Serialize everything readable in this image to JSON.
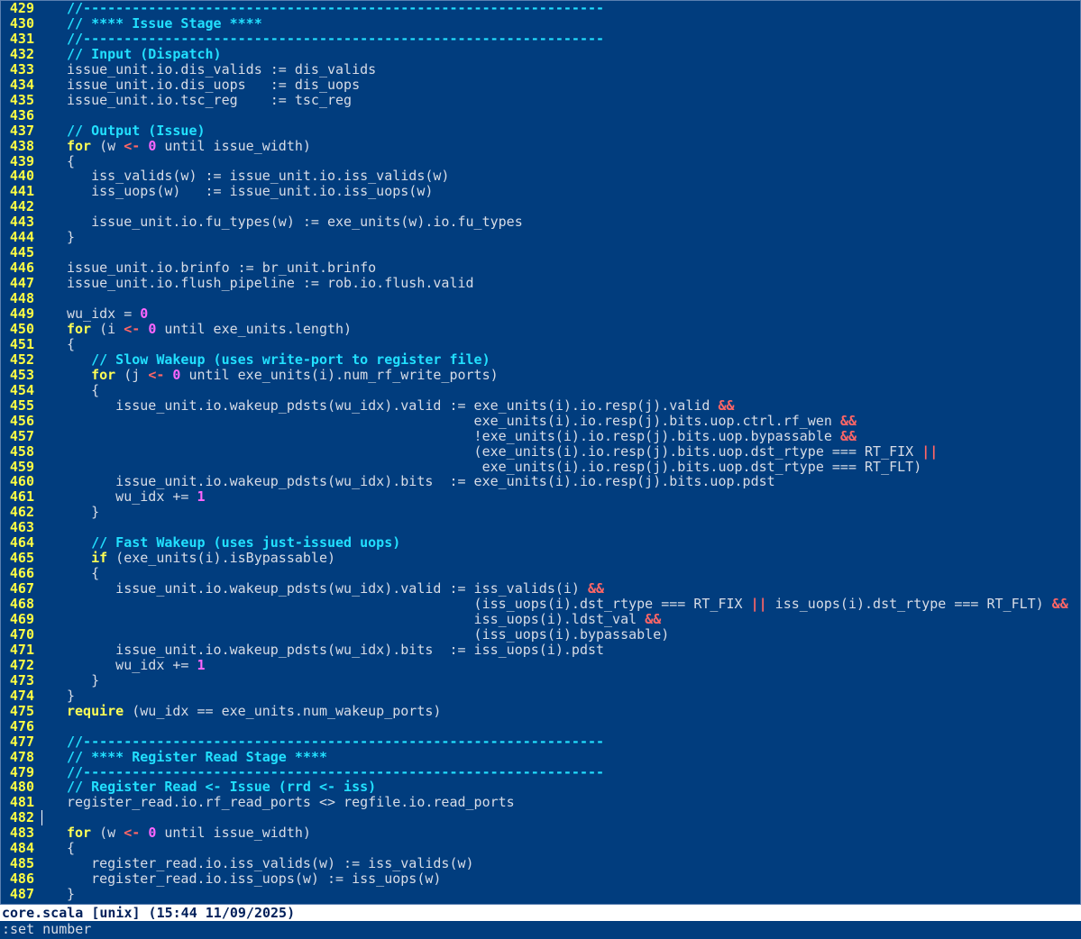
{
  "editor": {
    "file": "core.scala",
    "lines": [
      {
        "n": "429",
        "tokens": [
          [
            "comment",
            "//----------------------------------------------------------------"
          ]
        ]
      },
      {
        "n": "430",
        "tokens": [
          [
            "comment",
            "// **** Issue Stage ****"
          ]
        ]
      },
      {
        "n": "431",
        "tokens": [
          [
            "comment",
            "//----------------------------------------------------------------"
          ]
        ]
      },
      {
        "n": "432",
        "tokens": [
          [
            "comment",
            "// Input (Dispatch)"
          ]
        ]
      },
      {
        "n": "433",
        "tokens": [
          [
            "plain",
            "issue_unit.io.dis_valids := dis_valids"
          ]
        ]
      },
      {
        "n": "434",
        "tokens": [
          [
            "plain",
            "issue_unit.io.dis_uops   := dis_uops"
          ]
        ]
      },
      {
        "n": "435",
        "tokens": [
          [
            "plain",
            "issue_unit.io.tsc_reg    := tsc_reg"
          ]
        ]
      },
      {
        "n": "436",
        "tokens": []
      },
      {
        "n": "437",
        "tokens": [
          [
            "comment",
            "// Output (Issue)"
          ]
        ]
      },
      {
        "n": "438",
        "tokens": [
          [
            "keyword",
            "for"
          ],
          [
            "plain",
            " (w "
          ],
          [
            "op",
            "<-"
          ],
          [
            "plain",
            " "
          ],
          [
            "number",
            "0"
          ],
          [
            "plain",
            " until issue_width)"
          ]
        ]
      },
      {
        "n": "439",
        "tokens": [
          [
            "plain",
            "{"
          ]
        ]
      },
      {
        "n": "440",
        "tokens": [
          [
            "plain",
            "   iss_valids(w) := issue_unit.io.iss_valids(w)"
          ]
        ]
      },
      {
        "n": "441",
        "tokens": [
          [
            "plain",
            "   iss_uops(w)   := issue_unit.io.iss_uops(w)"
          ]
        ]
      },
      {
        "n": "442",
        "tokens": []
      },
      {
        "n": "443",
        "tokens": [
          [
            "plain",
            "   issue_unit.io.fu_types(w) := exe_units(w).io.fu_types"
          ]
        ]
      },
      {
        "n": "444",
        "tokens": [
          [
            "plain",
            "}"
          ]
        ]
      },
      {
        "n": "445",
        "tokens": []
      },
      {
        "n": "446",
        "tokens": [
          [
            "plain",
            "issue_unit.io.brinfo := br_unit.brinfo"
          ]
        ]
      },
      {
        "n": "447",
        "tokens": [
          [
            "plain",
            "issue_unit.io.flush_pipeline := rob.io.flush.valid"
          ]
        ]
      },
      {
        "n": "448",
        "tokens": []
      },
      {
        "n": "449",
        "tokens": [
          [
            "plain",
            "wu_idx = "
          ],
          [
            "number",
            "0"
          ]
        ]
      },
      {
        "n": "450",
        "tokens": [
          [
            "keyword",
            "for"
          ],
          [
            "plain",
            " (i "
          ],
          [
            "op",
            "<-"
          ],
          [
            "plain",
            " "
          ],
          [
            "number",
            "0"
          ],
          [
            "plain",
            " until exe_units.length)"
          ]
        ]
      },
      {
        "n": "451",
        "tokens": [
          [
            "plain",
            "{"
          ]
        ]
      },
      {
        "n": "452",
        "tokens": [
          [
            "plain",
            "   "
          ],
          [
            "comment",
            "// Slow Wakeup (uses write-port to register file)"
          ]
        ]
      },
      {
        "n": "453",
        "tokens": [
          [
            "plain",
            "   "
          ],
          [
            "keyword",
            "for"
          ],
          [
            "plain",
            " (j "
          ],
          [
            "op",
            "<-"
          ],
          [
            "plain",
            " "
          ],
          [
            "number",
            "0"
          ],
          [
            "plain",
            " until exe_units(i).num_rf_write_ports)"
          ]
        ]
      },
      {
        "n": "454",
        "tokens": [
          [
            "plain",
            "   {"
          ]
        ]
      },
      {
        "n": "455",
        "tokens": [
          [
            "plain",
            "      issue_unit.io.wakeup_pdsts(wu_idx).valid := exe_units(i).io.resp(j).valid "
          ],
          [
            "op",
            "&&"
          ]
        ]
      },
      {
        "n": "456",
        "tokens": [
          [
            "plain",
            "                                                  exe_units(i).io.resp(j).bits.uop.ctrl.rf_wen "
          ],
          [
            "op",
            "&&"
          ]
        ]
      },
      {
        "n": "457",
        "tokens": [
          [
            "plain",
            "                                                  !exe_units(i).io.resp(j).bits.uop.bypassable "
          ],
          [
            "op",
            "&&"
          ]
        ]
      },
      {
        "n": "458",
        "tokens": [
          [
            "plain",
            "                                                  (exe_units(i).io.resp(j).bits.uop.dst_rtype === RT_FIX "
          ],
          [
            "op",
            "||"
          ]
        ]
      },
      {
        "n": "459",
        "tokens": [
          [
            "plain",
            "                                                   exe_units(i).io.resp(j).bits.uop.dst_rtype === RT_FLT)"
          ]
        ]
      },
      {
        "n": "460",
        "tokens": [
          [
            "plain",
            "      issue_unit.io.wakeup_pdsts(wu_idx).bits  := exe_units(i).io.resp(j).bits.uop.pdst"
          ]
        ]
      },
      {
        "n": "461",
        "tokens": [
          [
            "plain",
            "      wu_idx += "
          ],
          [
            "number",
            "1"
          ]
        ]
      },
      {
        "n": "462",
        "tokens": [
          [
            "plain",
            "   }"
          ]
        ]
      },
      {
        "n": "463",
        "tokens": []
      },
      {
        "n": "464",
        "tokens": [
          [
            "plain",
            "   "
          ],
          [
            "comment",
            "// Fast Wakeup (uses just-issued uops)"
          ]
        ]
      },
      {
        "n": "465",
        "tokens": [
          [
            "plain",
            "   "
          ],
          [
            "keyword",
            "if"
          ],
          [
            "plain",
            " (exe_units(i).isBypassable)"
          ]
        ]
      },
      {
        "n": "466",
        "tokens": [
          [
            "plain",
            "   {"
          ]
        ]
      },
      {
        "n": "467",
        "tokens": [
          [
            "plain",
            "      issue_unit.io.wakeup_pdsts(wu_idx).valid := iss_valids(i) "
          ],
          [
            "op",
            "&&"
          ]
        ]
      },
      {
        "n": "468",
        "tokens": [
          [
            "plain",
            "                                                  (iss_uops(i).dst_rtype === RT_FIX "
          ],
          [
            "op",
            "||"
          ],
          [
            "plain",
            " iss_uops(i).dst_rtype === RT_FLT) "
          ],
          [
            "op",
            "&&"
          ]
        ]
      },
      {
        "n": "469",
        "tokens": [
          [
            "plain",
            "                                                  iss_uops(i).ldst_val "
          ],
          [
            "op",
            "&&"
          ]
        ]
      },
      {
        "n": "470",
        "tokens": [
          [
            "plain",
            "                                                  (iss_uops(i).bypassable)"
          ]
        ]
      },
      {
        "n": "471",
        "tokens": [
          [
            "plain",
            "      issue_unit.io.wakeup_pdsts(wu_idx).bits  := iss_uops(i).pdst"
          ]
        ]
      },
      {
        "n": "472",
        "tokens": [
          [
            "plain",
            "      wu_idx += "
          ],
          [
            "number",
            "1"
          ]
        ]
      },
      {
        "n": "473",
        "tokens": [
          [
            "plain",
            "   }"
          ]
        ]
      },
      {
        "n": "474",
        "tokens": [
          [
            "plain",
            "}"
          ]
        ]
      },
      {
        "n": "475",
        "tokens": [
          [
            "keyword",
            "require"
          ],
          [
            "plain",
            " (wu_idx == exe_units.num_wakeup_ports)"
          ]
        ]
      },
      {
        "n": "476",
        "tokens": []
      },
      {
        "n": "477",
        "tokens": [
          [
            "comment",
            "//----------------------------------------------------------------"
          ]
        ]
      },
      {
        "n": "478",
        "tokens": [
          [
            "comment",
            "// **** Register Read Stage ****"
          ]
        ]
      },
      {
        "n": "479",
        "tokens": [
          [
            "comment",
            "//----------------------------------------------------------------"
          ]
        ]
      },
      {
        "n": "480",
        "tokens": [
          [
            "comment",
            "// Register Read <- Issue (rrd <- iss)"
          ]
        ]
      },
      {
        "n": "481",
        "tokens": [
          [
            "plain",
            "register_read.io.rf_read_ports <> regfile.io.read_ports"
          ]
        ]
      },
      {
        "n": "482",
        "tokens": []
      },
      {
        "n": "483",
        "tokens": [
          [
            "keyword",
            "for"
          ],
          [
            "plain",
            " (w "
          ],
          [
            "op",
            "<-"
          ],
          [
            "plain",
            " "
          ],
          [
            "number",
            "0"
          ],
          [
            "plain",
            " until issue_width)"
          ]
        ]
      },
      {
        "n": "484",
        "tokens": [
          [
            "plain",
            "{"
          ]
        ]
      },
      {
        "n": "485",
        "tokens": [
          [
            "plain",
            "   register_read.io.iss_valids(w) := iss_valids(w)"
          ]
        ]
      },
      {
        "n": "486",
        "tokens": [
          [
            "plain",
            "   register_read.io.iss_uops(w) := iss_uops(w)"
          ]
        ]
      },
      {
        "n": "487",
        "tokens": [
          [
            "plain",
            "}"
          ]
        ]
      }
    ],
    "cursor_line": "482"
  },
  "statusbar": {
    "text": "core.scala [unix] (15:44 11/09/2025)"
  },
  "cmdline": {
    "text": ":set number"
  },
  "colors": {
    "background": "#013d7e",
    "line_number": "#ffff44",
    "comment": "#22e0ff",
    "keyword": "#ffff55",
    "number": "#ff66ff",
    "operator": "#ff6666",
    "plain": "#d7dce6"
  }
}
